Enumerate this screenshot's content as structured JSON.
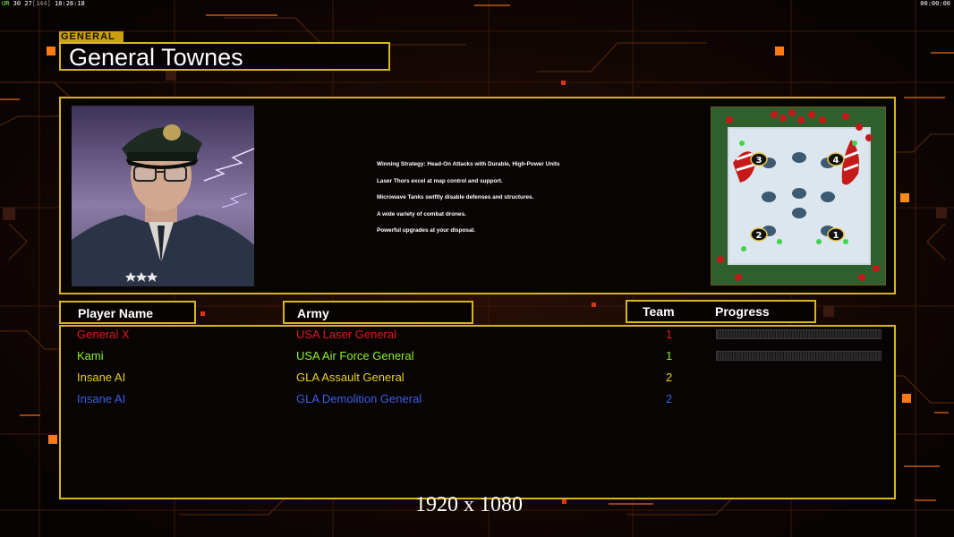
{
  "hud": {
    "ur_label": "UR",
    "fps": "30",
    "frame": "27",
    "frame_max": "[144]",
    "clock": "18:28:18",
    "timer": "00:00:00"
  },
  "general": {
    "tag": "GENERAL",
    "name": "General Townes"
  },
  "strategy_lines": [
    "Winning Strategy: Head-On Attacks with Durable, High-Power Units",
    "Laser Thors excel at map control and support.",
    "Microwave Tanks swiftly disable defenses and structures.",
    "A wide variety of combat drones.",
    "Powerful upgrades at your disposal."
  ],
  "map": {
    "start_markers": [
      "3",
      "4",
      "2",
      "1"
    ]
  },
  "columns": {
    "player_name": "Player Name",
    "army": "Army",
    "team": "Team",
    "progress": "Progress"
  },
  "players": [
    {
      "name": "General X",
      "army": "USA Laser General",
      "team": "1",
      "color": "#e0181b",
      "progress": 0
    },
    {
      "name": "Kami",
      "army": "USA Air Force General",
      "team": "1",
      "color": "#8df02a",
      "progress": 0
    },
    {
      "name": "Insane AI",
      "army": "GLA Assault General",
      "team": "2",
      "color": "#e6d21f",
      "progress": null
    },
    {
      "name": "Insane AI",
      "army": "GLA Demolition General",
      "team": "2",
      "color": "#3c5ee8",
      "progress": null
    }
  ],
  "resolution_label": "1920 x 1080",
  "colors": {
    "frame_yellow": "#d6b61c",
    "accent_orange": "#ff7a10",
    "background": "#0a0504"
  }
}
